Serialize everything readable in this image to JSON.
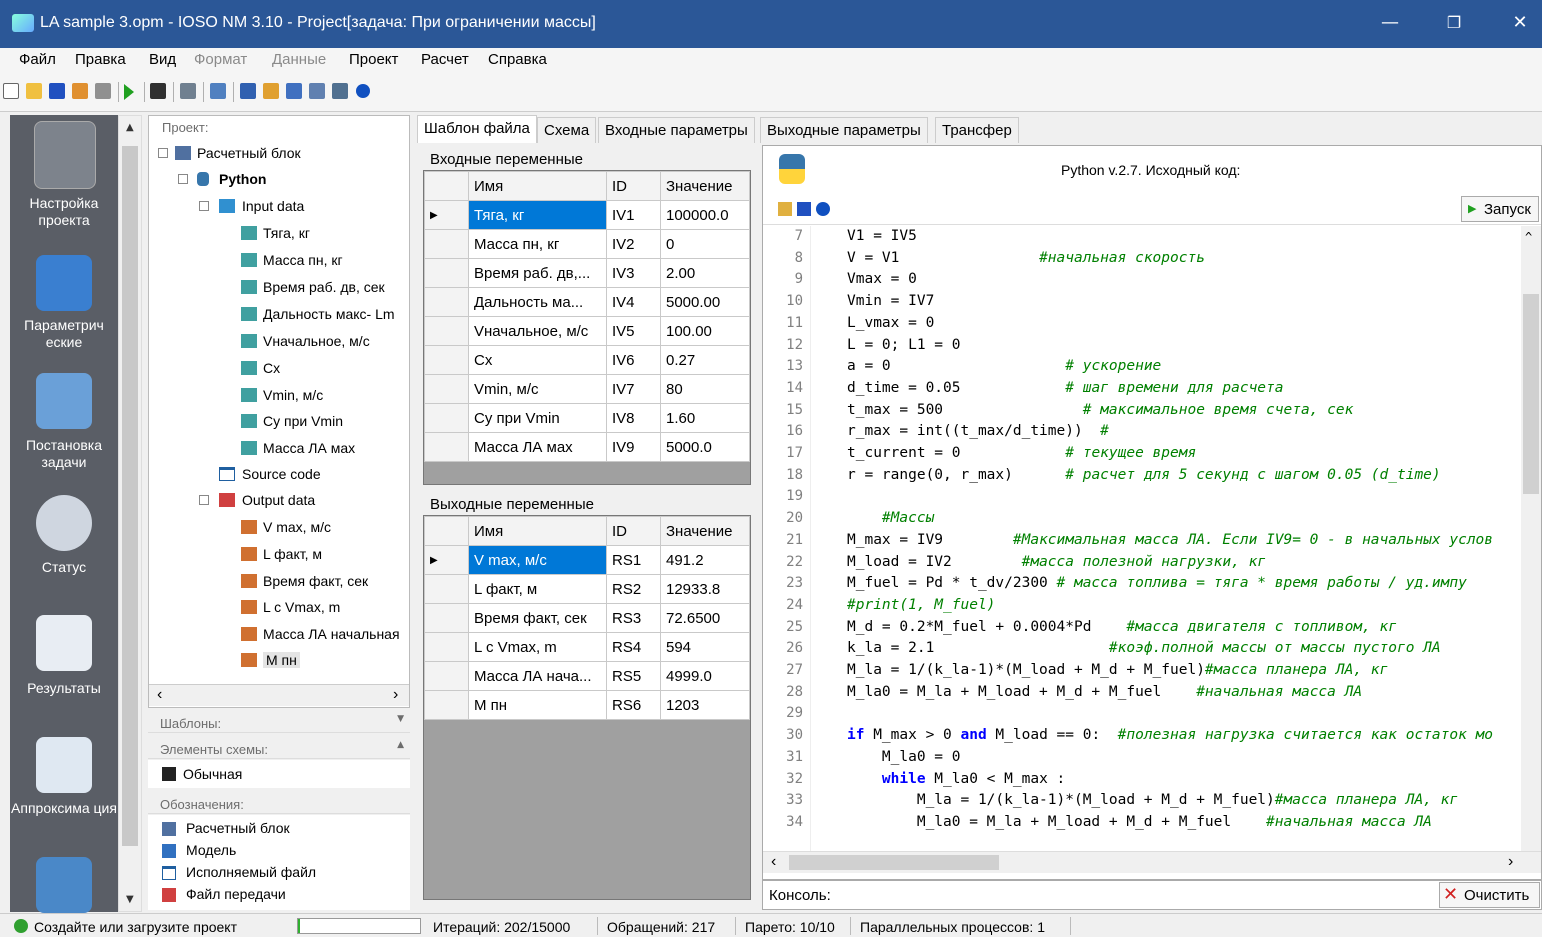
{
  "window": {
    "title": "LA sample 3.opm - IOSO NM 3.10 - Project[задача: При ограничении массы]",
    "minimize": "—",
    "restore": "❐",
    "close": "✕"
  },
  "menu": [
    "Файл",
    "Правка",
    "Вид",
    "Формат",
    "Данные",
    "Проект",
    "Расчет",
    "Справка"
  ],
  "nav": [
    "Настройка проекта",
    "Параметрич еские",
    "Постановка задачи",
    "Статус",
    "Результаты",
    "Аппроксима ция"
  ],
  "tree": {
    "header": "Проект:",
    "root": "Расчетный блок",
    "python": "Python",
    "input": "Input data",
    "inputs": [
      "Тяга, кг",
      "Масса пн, кг",
      "Время раб. дв, сек",
      "Дальность макс- Lm",
      "Vначальное, м/с",
      "Сх",
      "Vmin, м/с",
      "Су при Vmin",
      "Масса ЛА мах"
    ],
    "source": "Source code",
    "output": "Output data",
    "outputs": [
      "V max, м/с",
      "L факт, м",
      "Время факт, сек",
      "L c Vmax, m",
      "Масса ЛА начальная",
      "M пн"
    ]
  },
  "panels": {
    "templates": "Шаблоны:",
    "elements": "Элементы схемы:",
    "element_item": "Обычная",
    "legend": "Обозначения:",
    "legend_items": [
      "Расчетный блок",
      "Модель",
      "Исполняемый файл",
      "Файл передачи"
    ]
  },
  "tabs": [
    "Шаблон файла",
    "Схема",
    "Входные параметры",
    "Выходные параметры",
    "Трансфер"
  ],
  "inputs_grid": {
    "title": "Входные переменные",
    "headers": [
      "Имя",
      "ID",
      "Значение"
    ],
    "rows": [
      [
        "Тяга, кг",
        "IV1",
        "100000.0"
      ],
      [
        "Масса пн, кг",
        "IV2",
        "0"
      ],
      [
        "Время раб. дв,...",
        "IV3",
        "2.00"
      ],
      [
        "Дальность ма...",
        "IV4",
        "5000.00"
      ],
      [
        "Vначальное, м/с",
        "IV5",
        "100.00"
      ],
      [
        "Сх",
        "IV6",
        "0.27"
      ],
      [
        "Vmin, м/с",
        "IV7",
        "80"
      ],
      [
        "Су при Vmin",
        "IV8",
        "1.60"
      ],
      [
        "Масса ЛА мах",
        "IV9",
        "5000.0"
      ]
    ]
  },
  "outputs_grid": {
    "title": "Выходные переменные",
    "headers": [
      "Имя",
      "ID",
      "Значение"
    ],
    "rows": [
      [
        "V max, м/с",
        "RS1",
        "491.2"
      ],
      [
        "L факт, м",
        "RS2",
        "12933.8"
      ],
      [
        "Время факт, сек",
        "RS3",
        "72.6500"
      ],
      [
        "L c Vmax, m",
        "RS4",
        "594"
      ],
      [
        "Масса ЛА нача...",
        "RS5",
        "4999.0"
      ],
      [
        "M пн",
        "RS6",
        "1203"
      ]
    ]
  },
  "code": {
    "header": "Python v.2.7. Исходный код:",
    "run": "Запуск",
    "console": "Консоль:",
    "clear": "Очистить",
    "lines": [
      {
        "n": "7",
        "c": "V1 = IV5",
        "m": ""
      },
      {
        "n": "8",
        "c": "V = V1\t\t\t\t",
        "m": "#начальная скорость"
      },
      {
        "n": "9",
        "c": "Vmax = 0",
        "m": ""
      },
      {
        "n": "10",
        "c": "Vmin = IV7",
        "m": ""
      },
      {
        "n": "11",
        "c": "L_vmax = 0",
        "m": ""
      },
      {
        "n": "12",
        "c": "L = 0; L1 = 0",
        "m": ""
      },
      {
        "n": "13",
        "c": "a = 0\t\t\t\t\t",
        "m": "# ускорение"
      },
      {
        "n": "14",
        "c": "d_time = 0.05\t\t\t",
        "m": "# шаг времени для расчета"
      },
      {
        "n": "15",
        "c": "t_max = 500\t\t\t\t",
        "m": "# максимальное время счета, сек"
      },
      {
        "n": "16",
        "c": "r_max = int((t_max/d_time))  ",
        "m": "#"
      },
      {
        "n": "17",
        "c": "t_current = 0\t\t\t",
        "m": "# текущее время"
      },
      {
        "n": "18",
        "c": "r = range(0, r_max)  \t",
        "m": "# расчет для 5 секунд с шагом 0.05 (d_time)"
      },
      {
        "n": "19",
        "c": "",
        "m": ""
      },
      {
        "n": "20",
        "c": "\t",
        "m": "#Массы"
      },
      {
        "n": "21",
        "c": "M_max = IV9\t\t",
        "m": "#Максимальная масса ЛА. Если IV9= 0 - в начальных услов"
      },
      {
        "n": "22",
        "c": "M_load = IV2\t\t",
        "m": "#масса полезной нагрузки, кг"
      },
      {
        "n": "23",
        "c": "M_fuel = Pd * t_dv/2300 ",
        "m": "# масса топлива = тяга * время работы / уд.импу"
      },
      {
        "n": "24",
        "c": "",
        "m": "#print(1, M_fuel)"
      },
      {
        "n": "25",
        "c": "M_d = 0.2*M_fuel + 0.0004*Pd\t",
        "m": "#масса двигателя с топливом, кг"
      },
      {
        "n": "26",
        "c": "k_la = 2.1\t\t\t\t\t",
        "m": "#коэф.полной массы от массы пустого ЛА"
      },
      {
        "n": "27",
        "c": "M_la = 1/(k_la-1)*(M_load + M_d + M_fuel)",
        "m": "#масса планера ЛА, кг"
      },
      {
        "n": "28",
        "c": "M_la0 = M_la + M_load + M_d + M_fuel\t",
        "m": "#начальная масса ЛА"
      },
      {
        "n": "29",
        "c": "",
        "m": ""
      },
      {
        "n": "30",
        "c": "if M_max > 0 and M_load == 0:  ",
        "m": "#полезная нагрузка считается как остаток мо"
      },
      {
        "n": "31",
        "c": "\tM_la0 = 0",
        "m": ""
      },
      {
        "n": "32",
        "c": "\twhile M_la0 < M_max :",
        "m": ""
      },
      {
        "n": "33",
        "c": "\t\tM_la = 1/(k_la-1)*(M_load + M_d + M_fuel)",
        "m": "#масса планера ЛА, кг"
      },
      {
        "n": "34",
        "c": "\t\tM_la0 = M_la + M_load + M_d + M_fuel\t",
        "m": "#начальная масса ЛА"
      }
    ]
  },
  "status": {
    "msg": "Создайте или загрузите проект",
    "iter": "Итераций: 202/15000",
    "calls": "Обращений: 217",
    "pareto": "Парето: 10/10",
    "parallel": "Параллельных процессов: 1"
  },
  "colors": {
    "titlebar": "#2b5797",
    "nav": "#5a5e66",
    "selection": "#0078d7",
    "comment": "#008000",
    "keyword": "#0000ff"
  }
}
